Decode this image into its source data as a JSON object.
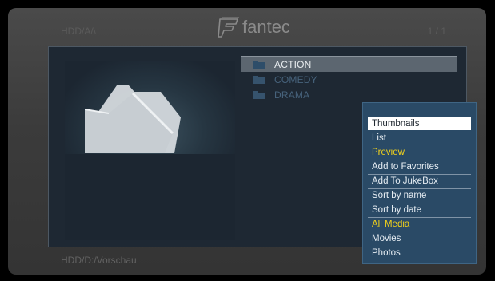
{
  "header": {
    "path": "HDD/A/\\",
    "logo_text": "fantec",
    "page_count": "1 / 1"
  },
  "folders": [
    {
      "label": "ACTION",
      "state": "selected"
    },
    {
      "label": "COMEDY",
      "state": "dim"
    },
    {
      "label": "DRAMA",
      "state": "dim"
    }
  ],
  "footer": {
    "path": "HDD/D:/Vorschau"
  },
  "context_menu": {
    "items": [
      {
        "label": "Thumbnails",
        "state": "highlight"
      },
      {
        "label": "List",
        "state": "normal"
      },
      {
        "label": "Preview",
        "state": "active"
      },
      {
        "label": "Add to Favorites",
        "state": "normal"
      },
      {
        "label": "Add To JukeBox",
        "state": "normal"
      },
      {
        "label": "Sort by name",
        "state": "normal"
      },
      {
        "label": "Sort by date",
        "state": "normal"
      },
      {
        "label": "All Media",
        "state": "active"
      },
      {
        "label": "Movies",
        "state": "normal"
      },
      {
        "label": "Photos",
        "state": "normal"
      }
    ]
  },
  "icons": {
    "logo": "fantec-logo-icon",
    "folder": "folder-icon",
    "preview": "folder-thumbnail-icon"
  },
  "colors": {
    "menu_background": "#2a4a66",
    "highlight_background": "#ffffff",
    "active_text": "#f2d21b",
    "folder_selected": "#2e4d69",
    "folder_dim": "#36536d"
  }
}
